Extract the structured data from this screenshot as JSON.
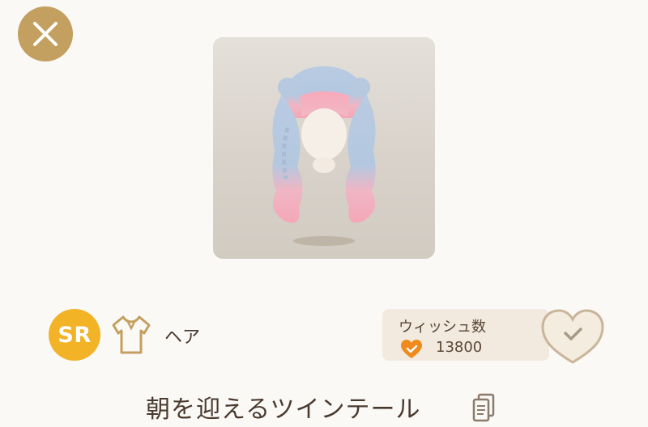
{
  "header": {
    "close_icon": "close-icon"
  },
  "item": {
    "name": "朝を迎えるツインテール",
    "rarity": "SR",
    "category": "ヘア",
    "category_icon": "shirt-icon"
  },
  "wish": {
    "label": "ウィッシュ数",
    "count": "13800",
    "count_icon": "heart-check-icon",
    "button_icon": "heart-check-outline-icon"
  },
  "colors": {
    "accent": "#c4a060",
    "rarity": "#f2b327",
    "heart": "#f08a1c",
    "text": "#4a3a2e"
  }
}
